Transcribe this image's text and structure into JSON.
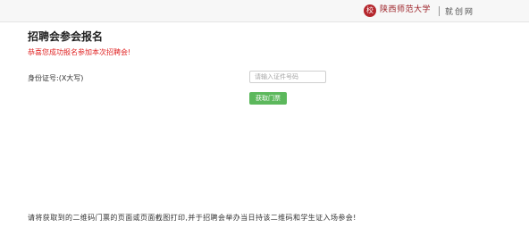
{
  "header": {
    "logo_text": "陕西师范大学",
    "site_name": "就创网"
  },
  "page": {
    "title": "招聘会参会报名",
    "success_message": "恭喜您成功报名参加本次招聘会!",
    "id_label": "身份证号:(X大写)",
    "id_input": {
      "value": "",
      "placeholder": "请输入证件号码"
    },
    "get_ticket_button": "获取门票",
    "notice": "请将获取到的二维码门票的页面或页面截图打印,并于招聘会举办当日持该二维码和学生证入场参会!"
  },
  "colors": {
    "success_text": "#e02424",
    "button_bg": "#5cb85c",
    "brand": "#9b1e24"
  }
}
